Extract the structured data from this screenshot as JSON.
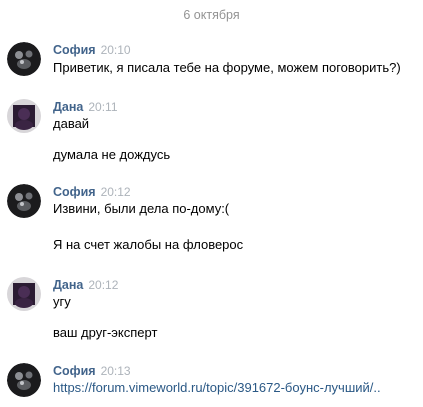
{
  "date": "6 октября",
  "messages": [
    {
      "author": "София",
      "time": "20:10",
      "lines": [
        "Приветик, я писала тебе на форуме, можем поговорить?)"
      ]
    },
    {
      "author": "Дана",
      "time": "20:11",
      "lines": [
        "давай",
        "думала не дождусь"
      ]
    },
    {
      "author": "София",
      "time": "20:12",
      "lines": [
        "Извини, были дела по-дому:(",
        "Я на счет жалобы на фловерос"
      ]
    },
    {
      "author": "Дана",
      "time": "20:12",
      "lines": [
        "угу",
        "ваш друг-эксперт"
      ]
    },
    {
      "author": "София",
      "time": "20:13",
      "link": "https://forum.vimeworld.ru/topic/391672-боунс-лучший/.."
    }
  ]
}
